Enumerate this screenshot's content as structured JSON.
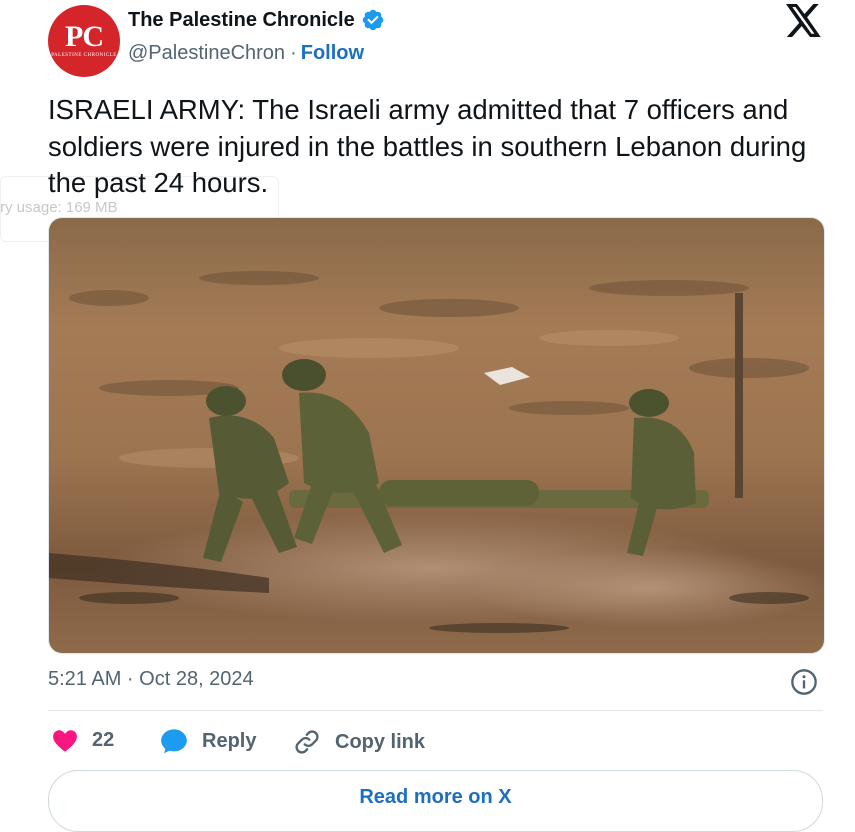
{
  "background_overlay": {
    "memory_text": "ry usage: 169 MB"
  },
  "author": {
    "avatar_text": "PC",
    "avatar_subtext": "PALESTINE CHRONICLE",
    "name": "The Palestine Chronicle",
    "handle": "@PalestineChron",
    "separator": "·",
    "follow_label": "Follow",
    "verified": true
  },
  "tweet": {
    "text": "ISRAELI ARMY: The Israeli army admitted that 7 officers and soldiers were injured in the battles in southern Lebanon during the past 24 hours.",
    "timestamp": "5:21 AM · Oct 28, 2024"
  },
  "actions": {
    "like_count": "22",
    "reply_label": "Reply",
    "copy_link_label": "Copy link"
  },
  "footer": {
    "read_more_label": "Read more on X"
  },
  "colors": {
    "brand_blue": "#1d6fbf",
    "like_pink": "#f91880",
    "reply_blue": "#1d9bf0",
    "avatar_red": "#d4252b",
    "muted": "#536471"
  },
  "icons": {
    "verified": "verified-badge-icon",
    "x_logo": "x-logo-icon",
    "info": "info-icon",
    "like": "heart-icon",
    "reply": "speech-bubble-icon",
    "copy_link": "link-icon"
  }
}
